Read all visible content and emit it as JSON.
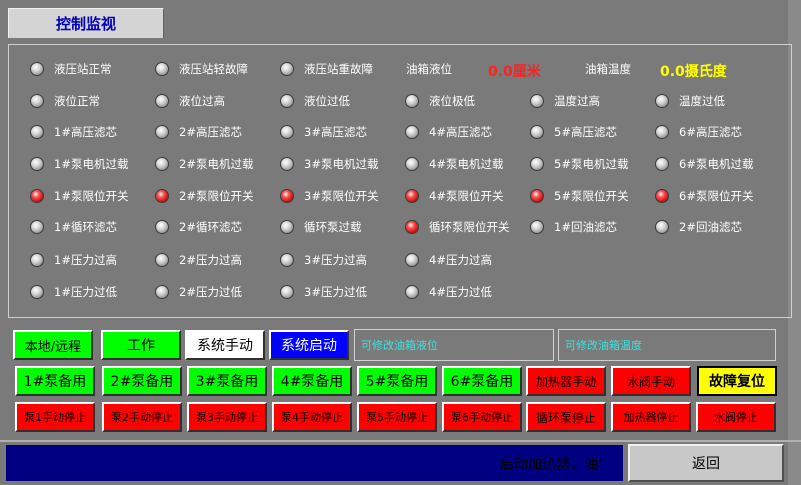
{
  "tab_title": "控制监视",
  "indicators": [
    {
      "label": "液压站正常",
      "on": false
    },
    {
      "label": "液压站轻故障",
      "on": false
    },
    {
      "label": "液压站重故障",
      "on": false
    },
    {
      "label": "液位正常",
      "on": false
    },
    {
      "label": "液位过高",
      "on": false
    },
    {
      "label": "液位过低",
      "on": false
    },
    {
      "label": "液位极低",
      "on": false
    },
    {
      "label": "温度过高",
      "on": false
    },
    {
      "label": "温度过低",
      "on": false
    },
    {
      "label": "1#高压滤芯",
      "on": false
    },
    {
      "label": "2#高压滤芯",
      "on": false
    },
    {
      "label": "3#高压滤芯",
      "on": false
    },
    {
      "label": "4#高压滤芯",
      "on": false
    },
    {
      "label": "5#高压滤芯",
      "on": false
    },
    {
      "label": "6#高压滤芯",
      "on": false
    },
    {
      "label": "1#泵电机过载",
      "on": false
    },
    {
      "label": "2#泵电机过载",
      "on": false
    },
    {
      "label": "3#泵电机过载",
      "on": false
    },
    {
      "label": "4#泵电机过载",
      "on": false
    },
    {
      "label": "5#泵电机过载",
      "on": false
    },
    {
      "label": "6#泵电机过载",
      "on": false
    },
    {
      "label": "1#泵限位开关",
      "on": true
    },
    {
      "label": "2#泵限位开关",
      "on": true
    },
    {
      "label": "3#泵限位开关",
      "on": true
    },
    {
      "label": "4#泵限位开关",
      "on": true
    },
    {
      "label": "5#泵限位开关",
      "on": true
    },
    {
      "label": "6#泵限位开关",
      "on": true
    },
    {
      "label": "1#循环滤芯",
      "on": false
    },
    {
      "label": "2#循环滤芯",
      "on": false
    },
    {
      "label": "循环泵过载",
      "on": false
    },
    {
      "label": "循环泵限位开关",
      "on": true
    },
    {
      "label": "1#回油滤芯",
      "on": false
    },
    {
      "label": "2#回油滤芯",
      "on": false
    },
    {
      "label": "1#压力过高",
      "on": false
    },
    {
      "label": "2#压力过高",
      "on": false
    },
    {
      "label": "3#压力过高",
      "on": false
    },
    {
      "label": "4#压力过高",
      "on": false
    },
    {
      "label": "1#压力过低",
      "on": false
    },
    {
      "label": "2#压力过低",
      "on": false
    },
    {
      "label": "3#压力过低",
      "on": false
    },
    {
      "label": "4#压力过低",
      "on": false
    }
  ],
  "readouts": {
    "tank_level_label": "油箱液位",
    "tank_level_value": "0.0厘米",
    "tank_temp_label": "油箱温度",
    "tank_temp_value": "0.0摄氏度"
  },
  "mode_buttons": {
    "local_remote": "本地/远程",
    "work": "工作",
    "manual": "系统手动",
    "start": "系统启动"
  },
  "fields": {
    "level_set": "可修改油箱液位",
    "temp_set": "可修改油箱温度"
  },
  "standby_buttons": [
    "1#泵备用",
    "2#泵备用",
    "3#泵备用",
    "4#泵备用",
    "5#泵备用",
    "6#泵备用",
    "加热器手动",
    "水阀手动"
  ],
  "fault_reset": "故障复位",
  "stop_buttons": [
    "泵1手动停止",
    "泵2手动停止",
    "泵3手动停止",
    "泵4手动停止",
    "泵5手动停止",
    "泵6手动停止",
    "循环泵停止",
    "加热器停止",
    "水阀停止"
  ],
  "status_text": "启动加热器，油’",
  "back_label": "返回",
  "colors": {
    "panel_bg": "#7a7a7a",
    "led_on": "#e00000",
    "green": "#00ff00",
    "red": "#ff0000",
    "blue": "#0000ff",
    "yellow": "#ffff00",
    "level_value": "#ff2020",
    "temp_value": "#ffff00"
  },
  "icons": [
    "indicator-lamp-icon"
  ]
}
